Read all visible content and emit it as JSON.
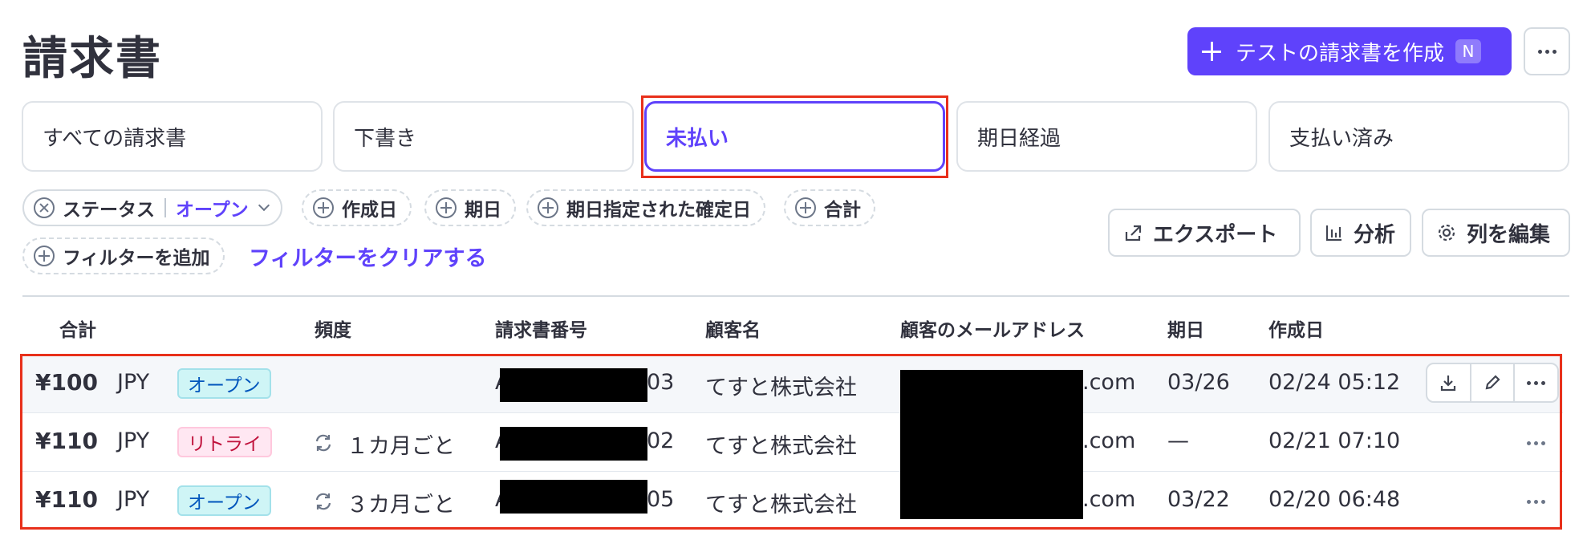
{
  "page": {
    "title": "請求書"
  },
  "header": {
    "create_label": "テストの請求書を作成",
    "create_shortcut": "N"
  },
  "tabs": [
    {
      "label": "すべての請求書",
      "active": false
    },
    {
      "label": "下書き",
      "active": false
    },
    {
      "label": "未払い",
      "active": true
    },
    {
      "label": "期日経過",
      "active": false
    },
    {
      "label": "支払い済み",
      "active": false
    }
  ],
  "filters": {
    "status_label": "ステータス",
    "status_value": "オープン",
    "chips": [
      "作成日",
      "期日",
      "期日指定された確定日",
      "合計"
    ],
    "add_label": "フィルターを追加",
    "clear_label": "フィルターをクリアする"
  },
  "toolbar": {
    "export_label": "エクスポート",
    "analyze_label": "分析",
    "edit_columns_label": "列を編集"
  },
  "table": {
    "columns": [
      "合計",
      "頻度",
      "請求書番号",
      "顧客名",
      "顧客のメールアドレス",
      "期日",
      "作成日"
    ],
    "rows": [
      {
        "amount": "¥100",
        "currency": "JPY",
        "status": "オープン",
        "status_type": "open",
        "frequency": "",
        "invoice_prefix": "A",
        "invoice_suffix": "03",
        "customer": "てすと株式会社",
        "email_suffix": ".com",
        "due": "03/26",
        "created": "02/24 05:12"
      },
      {
        "amount": "¥110",
        "currency": "JPY",
        "status": "リトライ",
        "status_type": "retry",
        "frequency": "１カ月ごと",
        "invoice_prefix": "A",
        "invoice_suffix": "02",
        "customer": "てすと株式会社",
        "email_suffix": ".com",
        "due": "—",
        "created": "02/21 07:10"
      },
      {
        "amount": "¥110",
        "currency": "JPY",
        "status": "オープン",
        "status_type": "open",
        "frequency": "３カ月ごと",
        "invoice_prefix": "A",
        "invoice_suffix": "05",
        "customer": "てすと株式会社",
        "email_suffix": ".com",
        "due": "03/22",
        "created": "02/20 06:48"
      }
    ]
  },
  "colors": {
    "accent": "#5f42fb",
    "highlight": "#e8301b",
    "open_badge": "#cff5f6",
    "retry_badge": "#ffe7f2"
  }
}
